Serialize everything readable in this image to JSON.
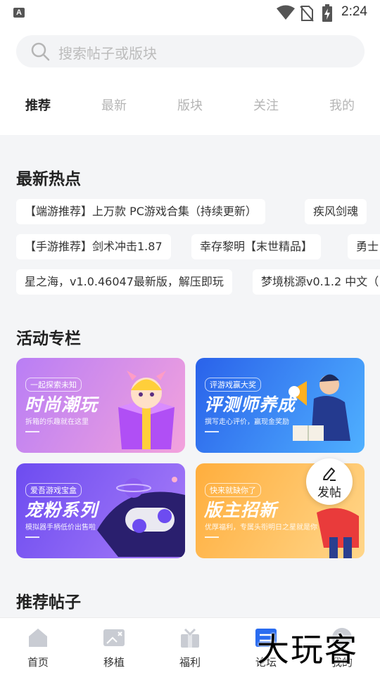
{
  "status_bar": {
    "time": "2:24",
    "notification_icon": "A"
  },
  "search": {
    "placeholder": "搜索帖子或版块"
  },
  "tabs": [
    {
      "label": "推荐",
      "active": true
    },
    {
      "label": "最新",
      "active": false
    },
    {
      "label": "版块",
      "active": false
    },
    {
      "label": "关注",
      "active": false
    },
    {
      "label": "我的",
      "active": false
    }
  ],
  "hot": {
    "title": "最新热点",
    "rows": [
      [
        "【端游推荐】上万款 PC游戏合集（持续更新）",
        "疾风剑魂"
      ],
      [
        "【手游推荐】剑术冲击1.87",
        "幸存黎明【末世精品】",
        "勇士"
      ],
      [
        "星之海，v1.0.46047最新版，解压即玩",
        "梦境桃源v0.1.2 中文（"
      ]
    ]
  },
  "activity": {
    "title": "活动专栏",
    "banners": [
      {
        "tag": "一起探索未知",
        "headline": "时尚潮玩",
        "sub": "拆箱的乐趣就在这里",
        "color_a": "#c785f5",
        "color_b": "#f3a2dc"
      },
      {
        "tag": "评游戏赢大奖",
        "headline": "评测师养成",
        "sub": "撰写走心评价，赢现金奖励",
        "color_a": "#2a6cf0",
        "color_b": "#4fb0ff"
      },
      {
        "tag": "爱吾游戏宝盒",
        "headline": "宠粉系列",
        "sub": "模拟器手柄低价出售啦",
        "color_a": "#7a4ff0",
        "color_b": "#a77cf8"
      },
      {
        "tag": "快来就缺你了",
        "headline": "版主招新",
        "sub": "优厚福利，专属头衔明日之星就是你",
        "color_a": "#ffb347",
        "color_b": "#ffd37a"
      }
    ]
  },
  "fab": {
    "label": "发帖",
    "icon": "pen-icon"
  },
  "recommended": {
    "title": "推荐帖子"
  },
  "bottom_nav": [
    {
      "label": "首页",
      "icon": "home-icon",
      "active": false
    },
    {
      "label": "移植",
      "icon": "gamepad-icon",
      "active": false
    },
    {
      "label": "福利",
      "icon": "gift-icon",
      "active": false
    },
    {
      "label": "论坛",
      "icon": "forum-icon",
      "active": true
    },
    {
      "label": "我的",
      "icon": "profile-icon",
      "active": false
    }
  ],
  "watermark": "大玩客",
  "colors": {
    "accent": "#2a6cf0",
    "inactive_icon": "#c9ccd3",
    "background": "#f4f5f7"
  }
}
